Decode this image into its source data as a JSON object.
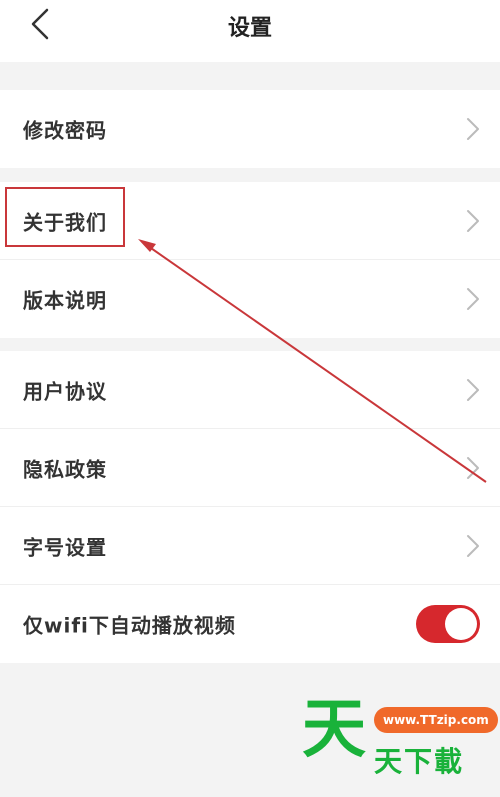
{
  "header": {
    "title": "设置",
    "back_icon": "chevron-left-icon"
  },
  "groups": [
    {
      "items": [
        {
          "label": "修改密码"
        }
      ]
    },
    {
      "items": [
        {
          "label": "关于我们"
        },
        {
          "label": "版本说明"
        }
      ]
    },
    {
      "items": [
        {
          "label": "用户协议"
        },
        {
          "label": "隐私政策"
        },
        {
          "label": "字号设置"
        },
        {
          "label": "仅wifi下自动播放视频",
          "toggle_on": true
        }
      ]
    }
  ],
  "colors": {
    "toggle_on": "#d6282d",
    "annotation": "#c9373a",
    "watermark_green": "#19b23a",
    "watermark_orange": "#f0692a"
  },
  "watermark": {
    "big_char": "天",
    "url": "www.TTzip.com",
    "text": "天下載"
  }
}
